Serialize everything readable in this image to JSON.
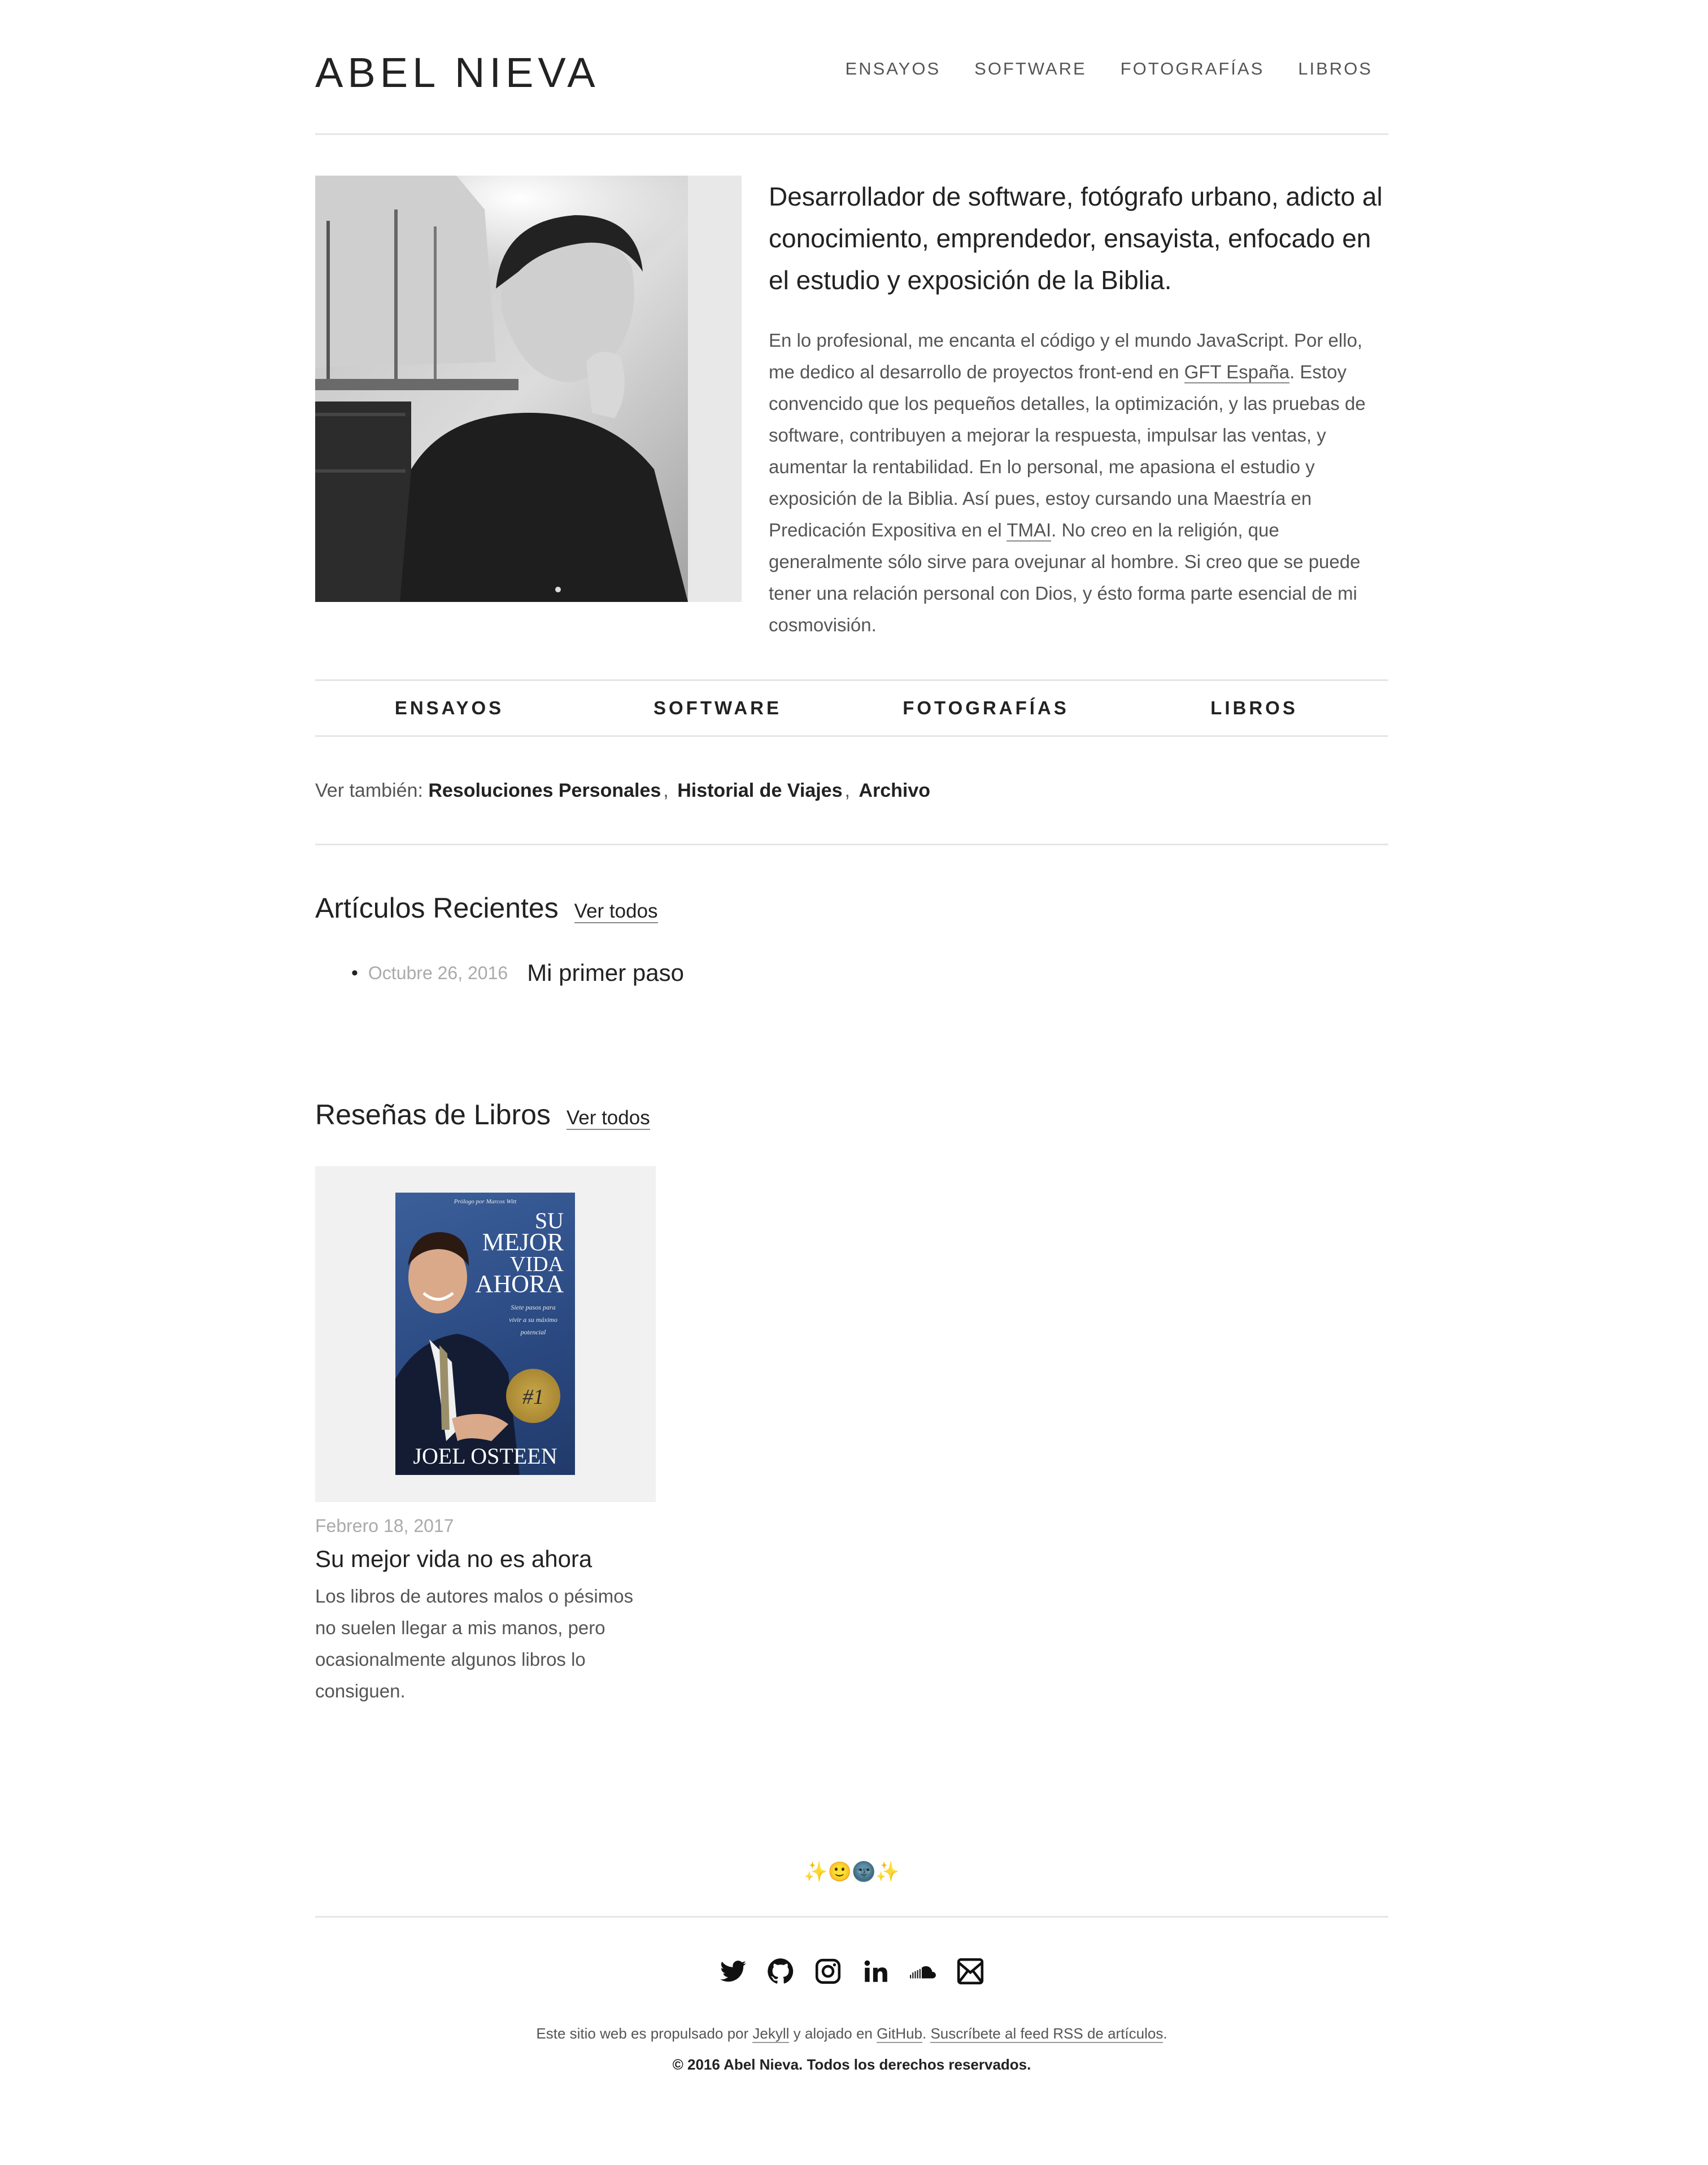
{
  "site": {
    "title": "ABEL NIEVA"
  },
  "nav": {
    "items": [
      "ENSAYOS",
      "SOFTWARE",
      "FOTOGRAFÍAS",
      "LIBROS"
    ]
  },
  "intro": {
    "lead": "Desarrollador de software, fotógrafo urbano, adicto al conocimiento, emprendedor, ensayista, enfocado en el estudio y exposición de la Biblia.",
    "bio_1": "En lo profesional, me encanta el código y el mundo JavaScript. Por ello, me dedico al desarrollo de proyectos front-end en ",
    "bio_link_1": "GFT España",
    "bio_2": ". Estoy convencido que los pequeños detalles, la optimización, y las pruebas de software, contribuyen a mejorar la respuesta, impulsar las ventas, y aumentar la rentabilidad. En lo personal, me apasiona el estudio y exposición de la Biblia. Así pues, estoy cursando una Maestría en Predicación Expositiva en el ",
    "bio_link_2": "TMAI",
    "bio_3": ". No creo en la religión, que generalmente sólo sirve para ovejunar al hombre. Si creo que se puede tener una relación personal con Dios, y ésto forma parte esencial de mi cosmovisión."
  },
  "section_nav": {
    "items": [
      "ENSAYOS",
      "SOFTWARE",
      "FOTOGRAFÍAS",
      "LIBROS"
    ]
  },
  "see_also": {
    "label": "Ver también:",
    "links": [
      "Resoluciones Personales",
      "Historial de Viajes",
      "Archivo"
    ],
    "separator": ","
  },
  "recent": {
    "title": "Artículos Recientes",
    "view_all": "Ver todos",
    "posts": [
      {
        "date": "Octubre 26, 2016",
        "title": "Mi primer paso"
      }
    ]
  },
  "books": {
    "title": "Reseñas de Libros",
    "view_all": "Ver todos",
    "items": [
      {
        "date": "Febrero 18, 2017",
        "title": "Su mejor vida no es ahora",
        "excerpt": "Los libros de autores malos o pésimos no suelen llegar a mis manos, pero ocasionalmente algunos libros lo consiguen.",
        "cover": {
          "prologue": "Prólogo por Marcos Witt",
          "su": "SU",
          "mejor": "MEJOR",
          "vida": "VIDA",
          "ahora": "AHORA",
          "subtitle": "Siete pasos para vivir a su máximo potencial",
          "badge": "#1",
          "author": "JOEL OSTEEN"
        }
      }
    ]
  },
  "footer": {
    "emoji": "✨🙂🌚✨",
    "social_icons": [
      "twitter-icon",
      "github-icon",
      "instagram-icon",
      "linkedin-icon",
      "soundcloud-icon",
      "email-icon"
    ],
    "text_1": "Este sitio web es propulsado por ",
    "link_jekyll": "Jekyll",
    "text_2": " y alojado en ",
    "link_github": "GitHub",
    "text_3": ". ",
    "link_rss": "Suscríbete al feed RSS de artículos",
    "text_4": ".",
    "copyright": "© 2016 Abel Nieva. Todos los derechos reservados."
  },
  "colors": {
    "text": "#222222",
    "muted": "#555555",
    "divider": "#e6e6e6",
    "book_bg": "#f1f1f1"
  }
}
